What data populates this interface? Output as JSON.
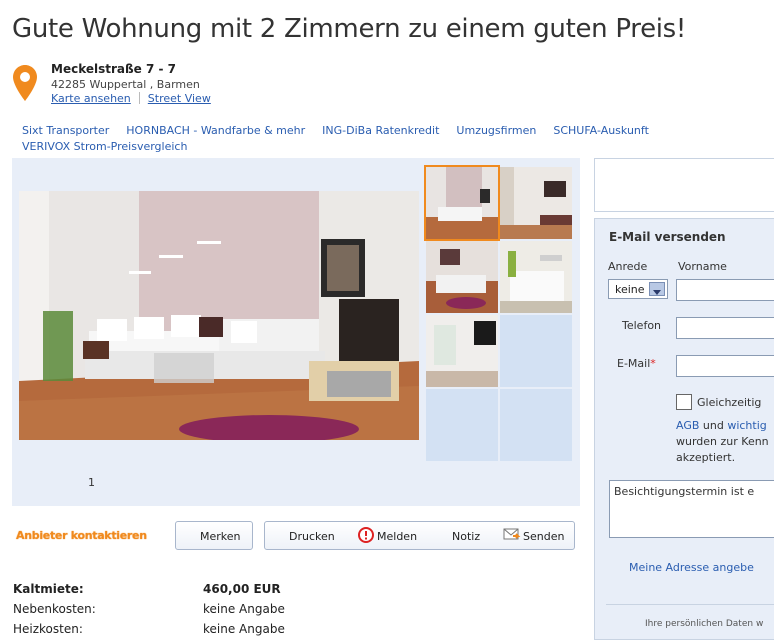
{
  "listing": {
    "title": "Gute Wohnung mit 2 Zimmern zu einem guten Preis!",
    "street": "Meckelstraße 7 - 7",
    "city": "42285 Wuppertal , Barmen",
    "map_link": "Karte ansehen",
    "streetview_link": "Street View"
  },
  "adlinks": [
    "Sixt Transporter",
    "HORNBACH - Wandfarbe & mehr",
    "ING-DiBa Ratenkredit",
    "Umzugsfirmen",
    "SCHUFA-Auskunft",
    "VERIVOX Strom-Preisvergleich"
  ],
  "gallery": {
    "page": "1"
  },
  "actions": {
    "contact": "Anbieter kontaktieren",
    "remember": "Merken",
    "print": "Drucken",
    "report": "Melden",
    "note": "Notiz",
    "send": "Senden"
  },
  "details": [
    {
      "key": "Kaltmiete:",
      "value": "460,00 EUR"
    },
    {
      "key": "Nebenkosten:",
      "value": "keine Angabe"
    },
    {
      "key": "Heizkosten:",
      "value": "keine Angabe"
    }
  ],
  "form": {
    "title": "E-Mail versenden",
    "salutation_label": "Anrede",
    "salutation_value": "keine",
    "firstname_label": "Vorname",
    "phone_label": "Telefon",
    "email_label": "E-Mail",
    "required_mark": "*",
    "checkbox_label": "Gleichzeitig",
    "agb": "AGB",
    "und": " und ",
    "wichtig": "wichtig",
    "terms_line2": "wurden zur Kenn",
    "terms_line3": "akzeptiert.",
    "message": "Besichtigungstermin ist e",
    "address_link": "Meine Adresse angebe",
    "privacy": "Ihre persönlichen Daten w"
  },
  "colors": {
    "accent": "#f08a1e",
    "link": "#2a5db0",
    "panel": "#e8eef8"
  }
}
